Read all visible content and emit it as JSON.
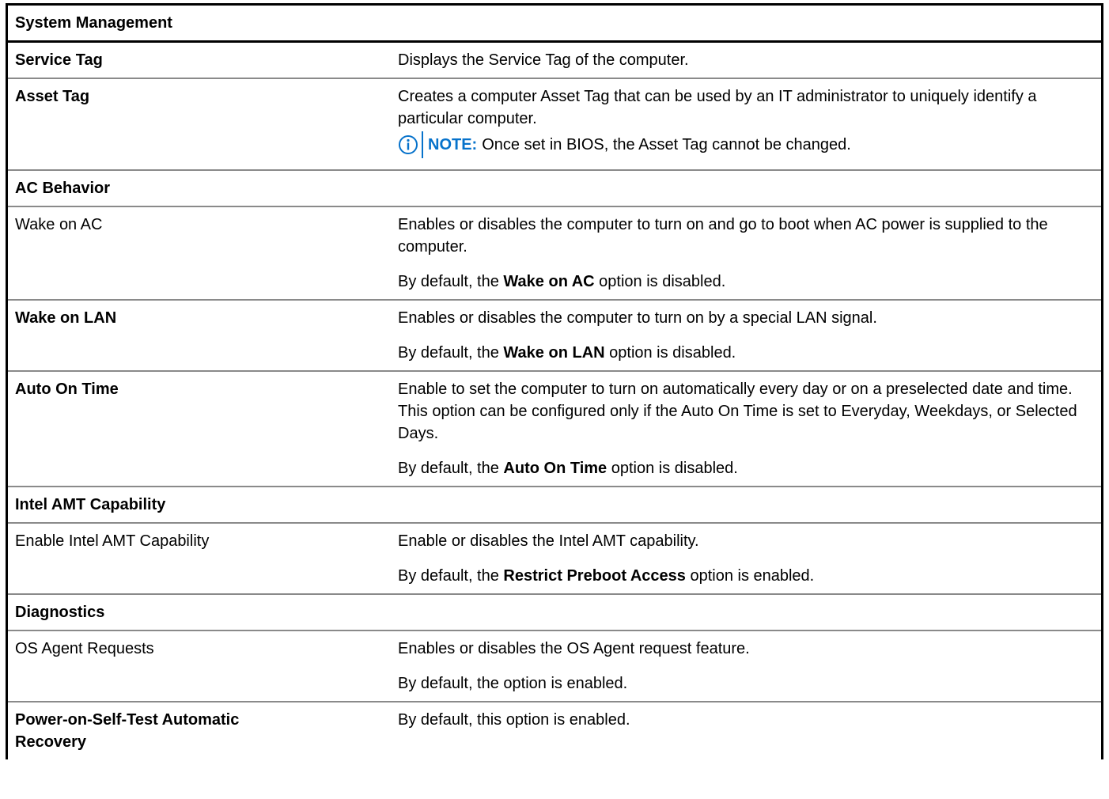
{
  "colors": {
    "note_accent": "#0672cb",
    "border": "#000000",
    "row_divider": "#8a8a8a"
  },
  "table": {
    "title": "System Management",
    "rows": {
      "service_tag": {
        "label": "Service Tag",
        "desc": "Displays the Service Tag of the computer."
      },
      "asset_tag": {
        "label": "Asset Tag",
        "desc": "Creates a computer Asset Tag that can be used by an IT administrator to uniquely identify a particular computer.",
        "note_icon": "info-circle-icon",
        "note_label": "NOTE:",
        "note_text": "Once set in BIOS, the Asset Tag cannot be changed."
      },
      "ac_behavior": {
        "label": "AC Behavior"
      },
      "wake_on_ac": {
        "label": "Wake on AC",
        "desc": "Enables or disables the computer to turn on and go to boot when AC power is supplied to the computer.",
        "default_prefix": "By default, the ",
        "default_option": "Wake on AC",
        "default_suffix": " option is disabled."
      },
      "wake_on_lan": {
        "label": "Wake on LAN",
        "desc": "Enables or disables the computer to turn on by a special LAN signal.",
        "default_prefix": "By default, the ",
        "default_option": "Wake on LAN",
        "default_suffix": " option is disabled."
      },
      "auto_on_time": {
        "label": "Auto On Time",
        "desc": "Enable to set the computer to turn on automatically every day or on a preselected date and time. This option can be configured only if the Auto On Time is set to Everyday, Weekdays, or Selected Days.",
        "default_prefix": "By default, the ",
        "default_option": "Auto On Time",
        "default_suffix": " option is disabled."
      },
      "intel_amt": {
        "label": "Intel AMT Capability"
      },
      "enable_intel_amt": {
        "label": "Enable Intel AMT Capability",
        "desc": "Enable or disables the Intel AMT capability.",
        "default_prefix": "By default, the ",
        "default_option": "Restrict Preboot Access",
        "default_suffix": " option is enabled."
      },
      "diagnostics": {
        "label": "Diagnostics"
      },
      "os_agent": {
        "label": "OS Agent Requests",
        "desc": "Enables or disables the OS Agent request feature.",
        "default_text": "By default, the option is enabled."
      },
      "post_recovery": {
        "label_line1": "Power-on-Self-Test Automatic",
        "label_line2": "Recovery",
        "desc": "By default, this option is enabled."
      }
    }
  }
}
